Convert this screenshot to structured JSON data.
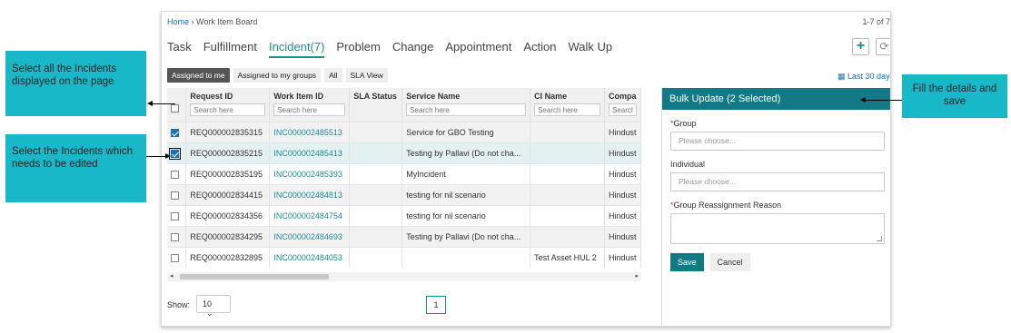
{
  "breadcrumb": {
    "home": "Home",
    "separator": "›",
    "current": "Work Item Board"
  },
  "record_count": "1-7 of 7",
  "tabs": [
    {
      "label": "Task",
      "active": false
    },
    {
      "label": "Fulfillment",
      "active": false
    },
    {
      "label": "Incident(7)",
      "active": true
    },
    {
      "label": "Problem",
      "active": false
    },
    {
      "label": "Change",
      "active": false
    },
    {
      "label": "Appointment",
      "active": false
    },
    {
      "label": "Action",
      "active": false
    },
    {
      "label": "Walk Up",
      "active": false
    }
  ],
  "toolbar": {
    "add_icon": "plus-icon",
    "refresh_icon": "refresh-icon"
  },
  "filters": [
    {
      "label": "Assigned to me",
      "active": true
    },
    {
      "label": "Assigned to my groups",
      "active": false
    },
    {
      "label": "All",
      "active": false
    },
    {
      "label": "SLA View",
      "active": false
    }
  ],
  "date_range": {
    "icon": "calendar-icon",
    "label": "Last 30 days"
  },
  "table": {
    "columns": [
      {
        "label": "Request ID",
        "placeholder": "Search here"
      },
      {
        "label": "Work Item ID",
        "placeholder": "Search here"
      },
      {
        "label": "SLA Status",
        "placeholder": ""
      },
      {
        "label": "Service Name",
        "placeholder": "Search here"
      },
      {
        "label": "CI Name",
        "placeholder": "Search here"
      },
      {
        "label": "Compa",
        "placeholder": "Search"
      }
    ],
    "rows": [
      {
        "checked": true,
        "request_id": "REQ000002835315",
        "work_item_id": "INC000002485513",
        "sla": "",
        "service": "Service for GBO Testing",
        "ci": "",
        "company": "Hindust"
      },
      {
        "checked": true,
        "request_id": "REQ000002835215",
        "work_item_id": "INC000002485413",
        "sla": "",
        "service": "Testing by Pallavi (Do not cha...",
        "ci": "",
        "company": "Hindust"
      },
      {
        "checked": false,
        "request_id": "REQ000002835195",
        "work_item_id": "INC000002485393",
        "sla": "",
        "service": "MyIncident",
        "ci": "",
        "company": "Hindust"
      },
      {
        "checked": false,
        "request_id": "REQ000002834415",
        "work_item_id": "INC000002484813",
        "sla": "",
        "service": "testing for nil scenario",
        "ci": "",
        "company": "Hindust"
      },
      {
        "checked": false,
        "request_id": "REQ000002834356",
        "work_item_id": "INC000002484754",
        "sla": "",
        "service": "testing for nil scenario",
        "ci": "",
        "company": "Hindust"
      },
      {
        "checked": false,
        "request_id": "REQ000002834295",
        "work_item_id": "INC000002484693",
        "sla": "",
        "service": "Testing by Pallavi (Do not cha...",
        "ci": "",
        "company": "Hindust"
      },
      {
        "checked": false,
        "request_id": "REQ000002832895",
        "work_item_id": "INC000002484053",
        "sla": "",
        "service": "",
        "ci": "Test Asset HUL 2",
        "company": "Hindust"
      }
    ]
  },
  "pagination": {
    "show_label": "Show:",
    "page_size": "10",
    "current_page": "1"
  },
  "bulk_update": {
    "title": "Bulk Update (2 Selected)",
    "group_label": "Group",
    "group_placeholder": "Please choose...",
    "individual_label": "Individual",
    "individual_placeholder": "Please choose...",
    "reason_label": "Group Reassignment Reason",
    "required_marker": "*",
    "save_label": "Save",
    "cancel_label": "Cancel"
  },
  "callouts": {
    "select_all": "Select all the Incidents displayed on the page",
    "select_incidents": "Select the Incidents which needs to be edited",
    "fill_details": "Fill the details and save"
  },
  "colors": {
    "accent": "#137a85",
    "link": "#1a8d9a",
    "callout": "#18b8c9"
  }
}
